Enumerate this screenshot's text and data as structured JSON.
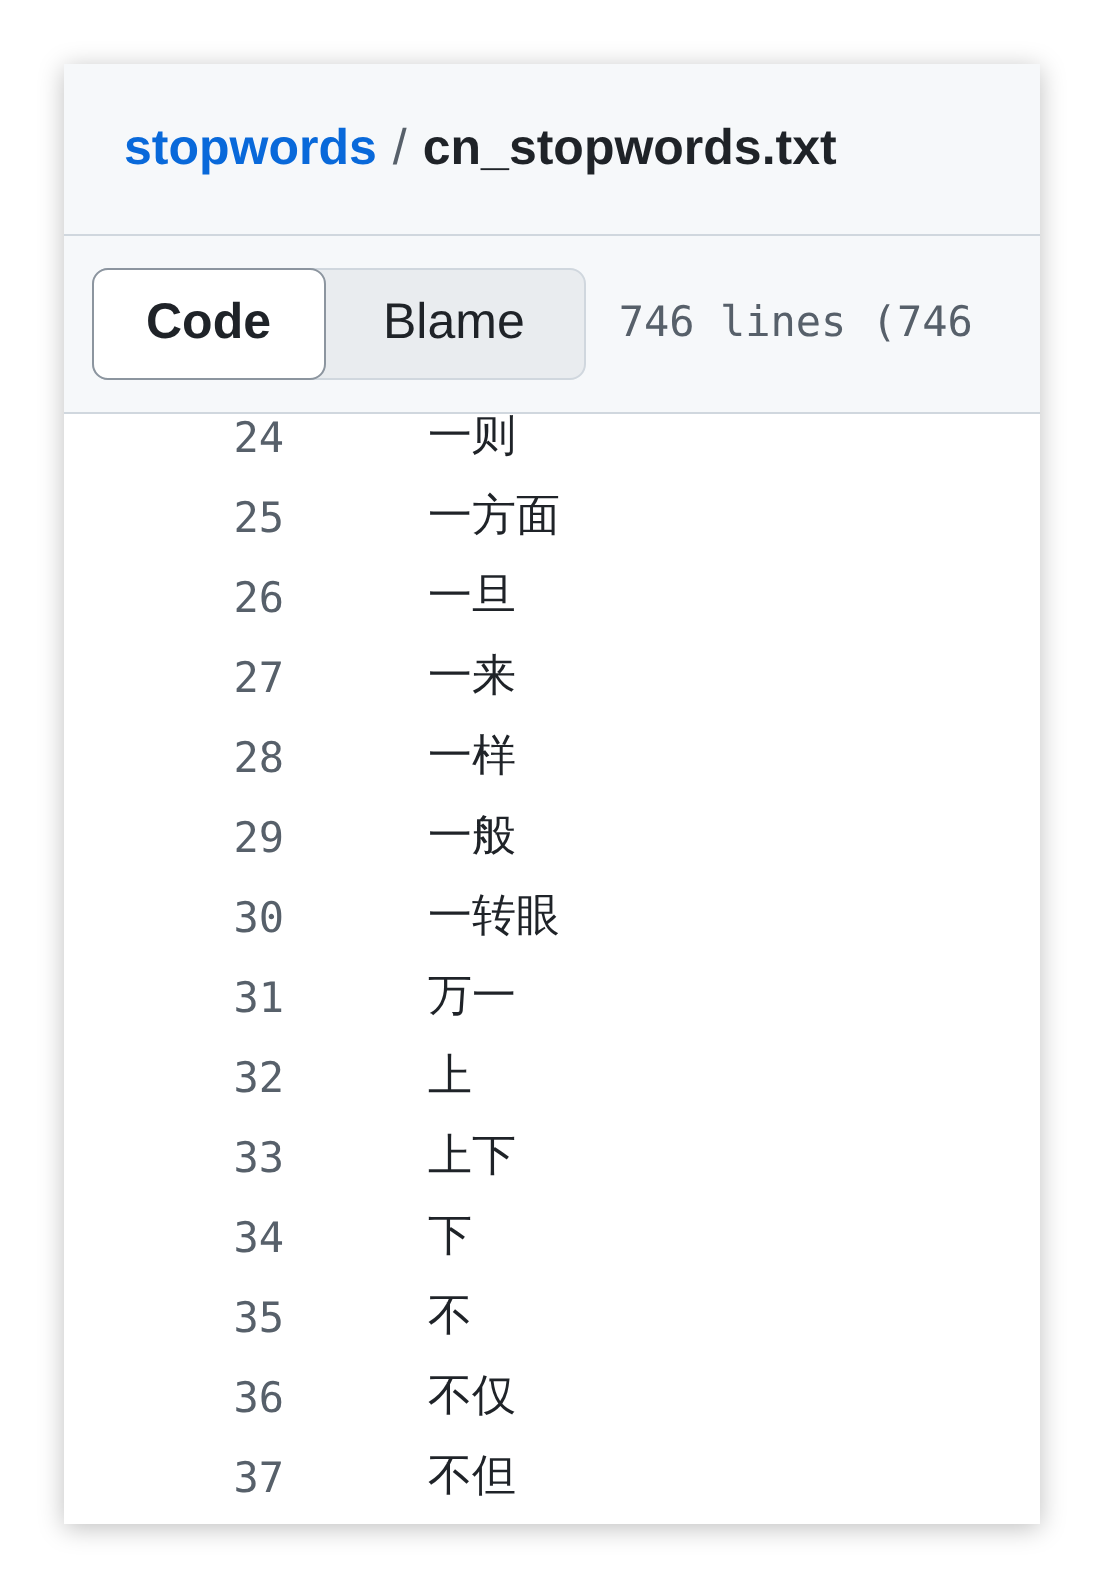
{
  "breadcrumb": {
    "repo": "stopwords",
    "separator": "/",
    "file": "cn_stopwords.txt"
  },
  "tabs": [
    {
      "label": "Code",
      "selected": true
    },
    {
      "label": "Blame",
      "selected": false
    }
  ],
  "file_info": "746 lines (746",
  "lines": [
    {
      "number": "24",
      "text": "一则"
    },
    {
      "number": "25",
      "text": "一方面"
    },
    {
      "number": "26",
      "text": "一旦"
    },
    {
      "number": "27",
      "text": "一来"
    },
    {
      "number": "28",
      "text": "一样"
    },
    {
      "number": "29",
      "text": "一般"
    },
    {
      "number": "30",
      "text": "一转眼"
    },
    {
      "number": "31",
      "text": "万一"
    },
    {
      "number": "32",
      "text": "上"
    },
    {
      "number": "33",
      "text": "上下"
    },
    {
      "number": "34",
      "text": "下"
    },
    {
      "number": "35",
      "text": "不"
    },
    {
      "number": "36",
      "text": "不仅"
    },
    {
      "number": "37",
      "text": "不但"
    }
  ]
}
